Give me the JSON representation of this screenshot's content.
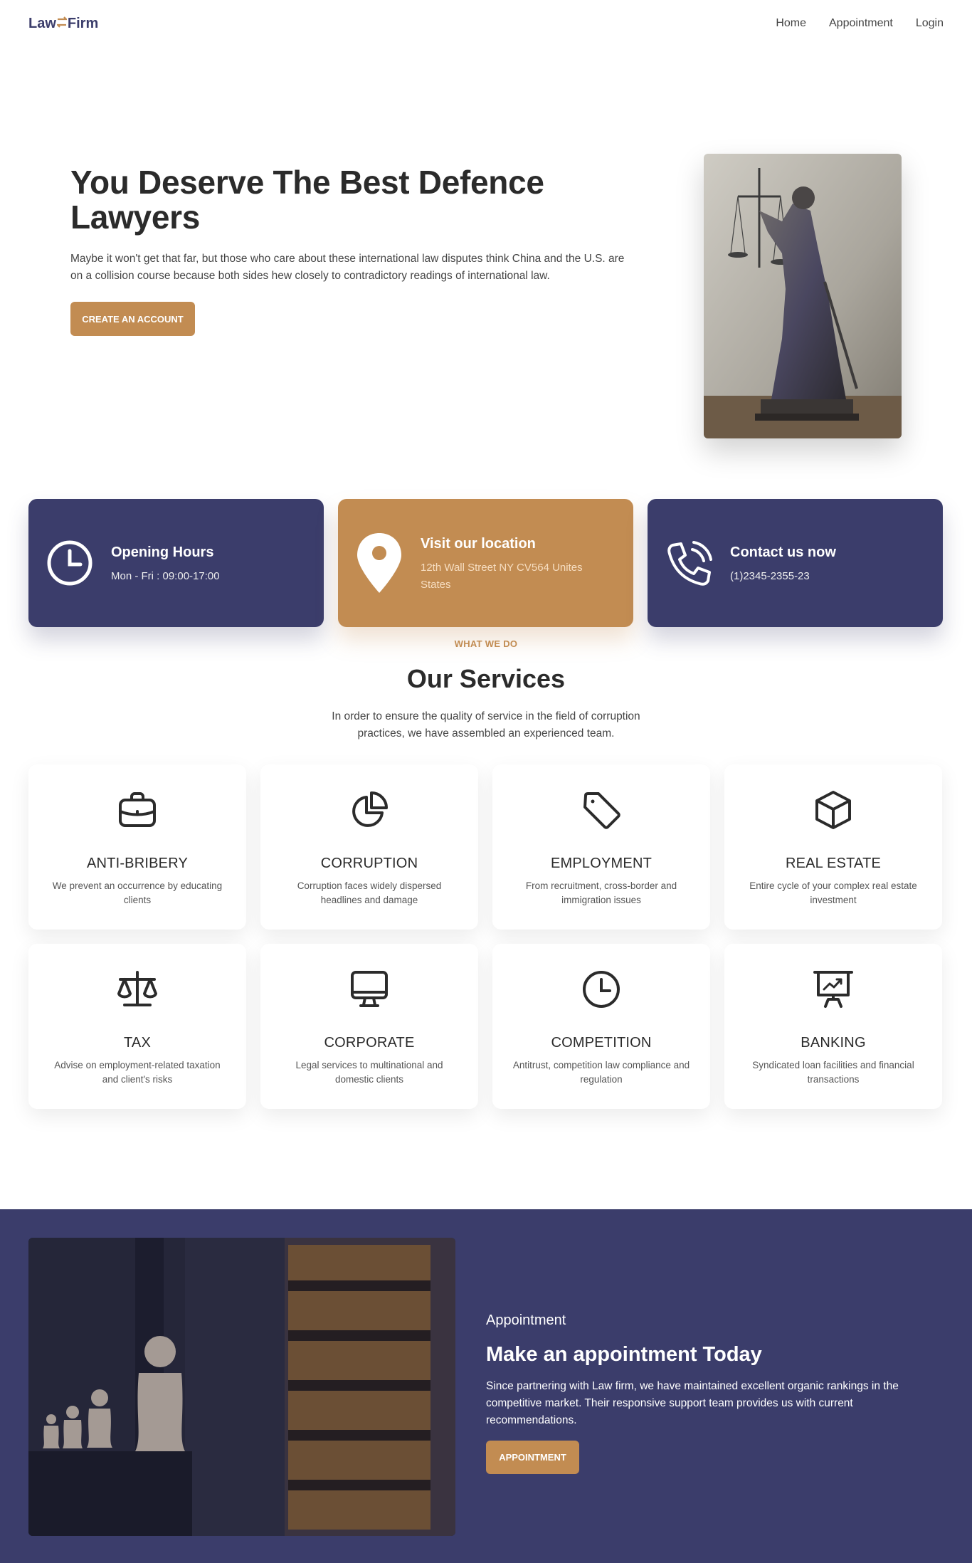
{
  "nav": {
    "logo_left": "Law",
    "logo_right": "Firm",
    "links": [
      "Home",
      "Appointment",
      "Login"
    ]
  },
  "hero": {
    "title": "You Deserve The Best Defence Lawyers",
    "description": "Maybe it won't get that far, but those who care about these international law disputes think China and the U.S. are on a collision course because both sides hew closely to contradictory readings of international law.",
    "button": "CREATE AN ACCOUNT"
  },
  "info": [
    {
      "title": "Opening Hours",
      "text": "Mon - Fri : 09:00-17:00",
      "icon": "clock-icon"
    },
    {
      "title": "Visit our location",
      "text": "12th Wall Street NY CV564 Unites States",
      "icon": "location-pin-icon"
    },
    {
      "title": "Contact us now",
      "text": "(1)2345-2355-23",
      "icon": "phone-icon"
    }
  ],
  "services": {
    "eyebrow": "WHAT WE DO",
    "title": "Our Services",
    "description": "In order to ensure the quality of service in the field of corruption practices, we have assembled an experienced team.",
    "items": [
      {
        "title": "ANTI-BRIBERY",
        "text": "We prevent an occurrence by educating clients",
        "icon": "briefcase-icon"
      },
      {
        "title": "CORRUPTION",
        "text": "Corruption faces widely dispersed headlines and damage",
        "icon": "pie-chart-icon"
      },
      {
        "title": "EMPLOYMENT",
        "text": "From recruitment, cross-border and immigration issues",
        "icon": "tag-icon"
      },
      {
        "title": "REAL ESTATE",
        "text": "Entire cycle of your complex real estate investment",
        "icon": "box-icon"
      },
      {
        "title": "TAX",
        "text": "Advise on employment-related taxation and client's risks",
        "icon": "scales-icon"
      },
      {
        "title": "CORPORATE",
        "text": "Legal services to multinational and domestic clients",
        "icon": "monitor-icon"
      },
      {
        "title": "COMPETITION",
        "text": "Antitrust, competition law compliance and regulation",
        "icon": "clock-icon"
      },
      {
        "title": "BANKING",
        "text": "Syndicated loan facilities and financial transactions",
        "icon": "presentation-chart-icon"
      }
    ]
  },
  "appointment": {
    "eyebrow": "Appointment",
    "title": "Make an appointment Today",
    "description": "Since partnering with Law firm, we have maintained excellent organic rankings in the competitive market. Their responsive support team provides us with current recommendations.",
    "button": "APPOINTMENT"
  },
  "colors": {
    "navy": "#3b3d6b",
    "gold": "#c28c52"
  }
}
